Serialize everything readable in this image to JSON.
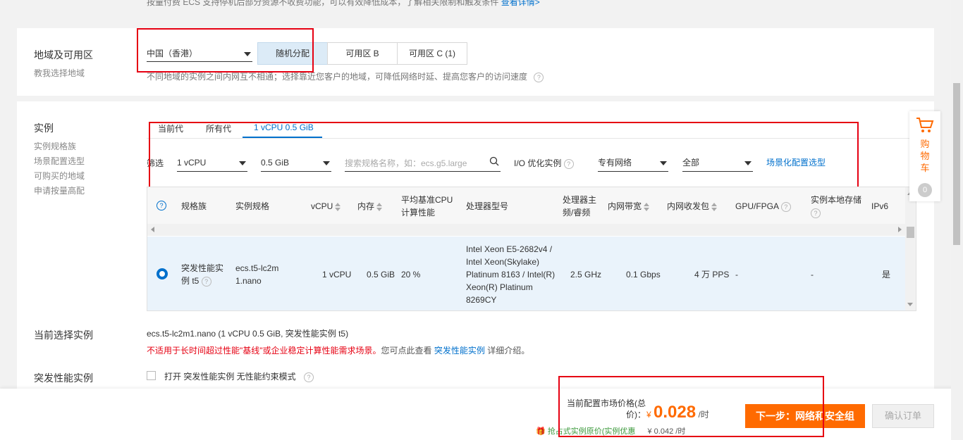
{
  "top": {
    "notice": "按量付费 ECS 支持停机后部分资源不收费功能，可以有效降低成本，了解相关限制和触发条件",
    "notice_link": "查看详情>"
  },
  "region": {
    "title": "地域及可用区",
    "subtitle": "教我选择地域",
    "selected_region": "中国（香港）",
    "zones": [
      "随机分配",
      "可用区 B",
      "可用区 C (1)"
    ],
    "note": "不同地域的实例之间内网互不相通；选择靠近您客户的地域，可降低网络时延、提高您客户的访问速度",
    "help_icon": "?"
  },
  "instance": {
    "title": "实例",
    "side_links": [
      "实例规格族",
      "场景配置选型",
      "可购买的地域",
      "申请按量高配"
    ],
    "tabs": [
      "当前代",
      "所有代",
      "1 vCPU 0.5 GiB"
    ],
    "filter_label": "筛选",
    "filter_vcpu": "1 vCPU",
    "filter_mem": "0.5 GiB",
    "search_placeholder": "搜索规格名称，如：ecs.g5.large",
    "io_label": "I/O 优化实例",
    "net_type": "专有网络",
    "all_option": "全部",
    "scene_link": "场景化配置选型",
    "headers": {
      "family": "规格族",
      "spec": "实例规格",
      "vcpu": "vCPU",
      "mem": "内存",
      "baseline": "平均基准CPU计算性能",
      "cpu_model": "处理器型号",
      "clock": "处理器主频/睿频",
      "bandwidth": "内网带宽",
      "pps": "内网收发包",
      "gpu": "GPU/FPGA",
      "local_storage": "实例本地存储",
      "ipv6": "IPv6"
    },
    "row": {
      "family": "突发性能实例 t5",
      "spec": "ecs.t5-lc2m1.nano",
      "vcpu": "1 vCPU",
      "mem": "0.5 GiB",
      "baseline": "20 %",
      "cpu_model": "Intel Xeon E5-2682v4 / Intel Xeon(Skylake) Platinum 8163 / Intel(R) Xeon(R) Platinum 8269CY",
      "clock": "2.5 GHz",
      "bandwidth": "0.1 Gbps",
      "pps": "4 万 PPS",
      "gpu": "-",
      "local_storage": "-",
      "ipv6": "是"
    }
  },
  "current": {
    "label": "当前选择实例",
    "value": "ecs.t5-lc2m1.nano (1 vCPU 0.5 GiB, 突发性能实例 t5)",
    "warning": "不适用于长时间超过性能\"基线\"或企业稳定计算性能需求场景。",
    "warning_tail": "您可点此查看",
    "warning_link": "突发性能实例",
    "warning_end": "详细介绍。"
  },
  "burst": {
    "label": "突发性能实例",
    "option": "打开 突发性能实例 无性能约束模式"
  },
  "bottom": {
    "price_label": "当前配置市场价格(总价)：",
    "currency": "¥",
    "price": "0.028",
    "unit": "/时",
    "promo": "抢占式实例原价(实例优惠",
    "promo_price": "¥ 0.042 /时",
    "next_button": "下一步：网络和安全组",
    "confirm_button": "确认订单"
  },
  "cart": {
    "label": "购物车",
    "count": "0"
  },
  "colors": {
    "accent": "#ff6a00",
    "link": "#0070cc",
    "annotation": "#e60012",
    "selected_zone": "#dcebf7"
  }
}
